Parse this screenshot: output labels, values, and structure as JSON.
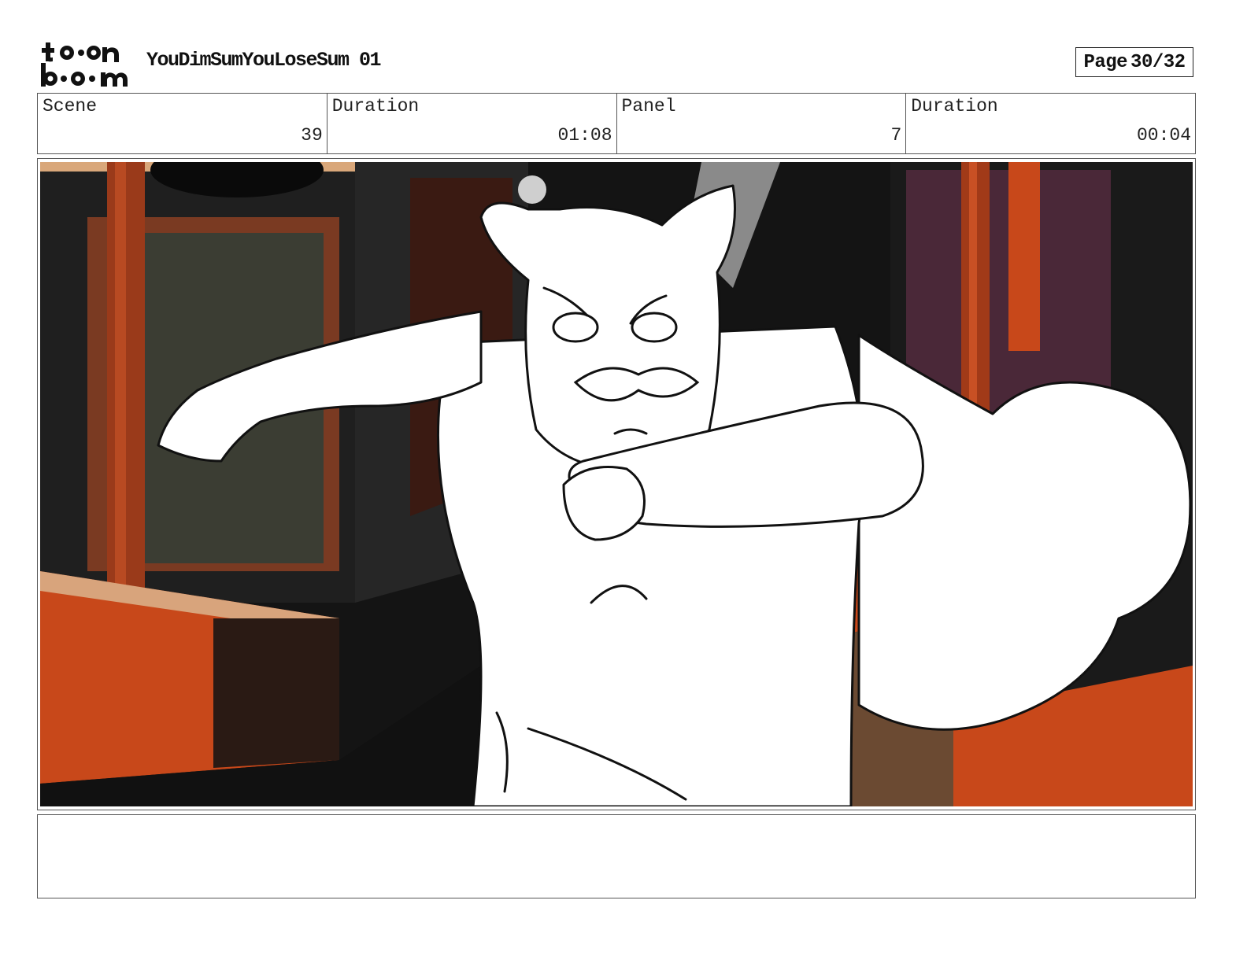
{
  "header": {
    "logo_text": "toon boom",
    "project_title": "YouDimSumYouLoseSum 01",
    "page_label": "Page",
    "page_number": "30/32"
  },
  "info": {
    "scene_label": "Scene",
    "scene_value": "39",
    "scene_duration_label": "Duration",
    "scene_duration_value": "01:08",
    "panel_label": "Panel",
    "panel_value": "7",
    "panel_duration_label": "Duration",
    "panel_duration_value": "00:04"
  },
  "panel": {
    "image_description_icon": "storyboard-frame",
    "notes": ""
  }
}
